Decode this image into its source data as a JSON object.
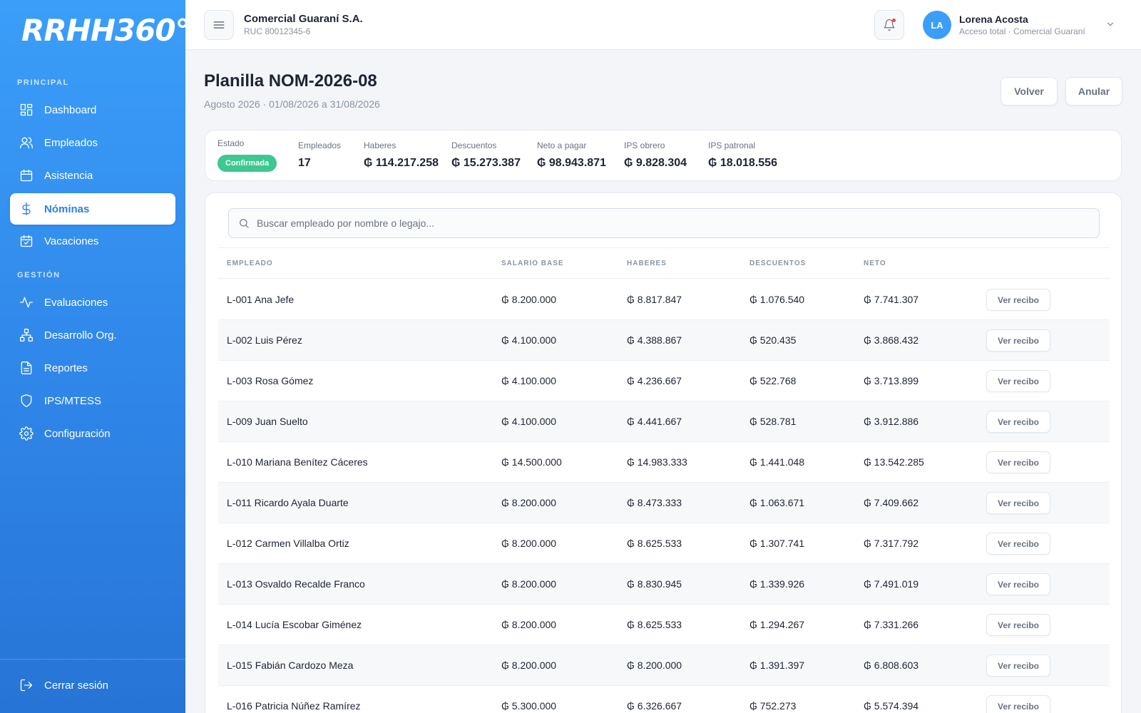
{
  "brand": {
    "logo": "RRHH360°"
  },
  "sidebar": {
    "principal_title": "PRINCIPAL",
    "gestion_title": "GESTIÓN",
    "principal": [
      {
        "label": "Dashboard",
        "icon": "dashboard-icon"
      },
      {
        "label": "Empleados",
        "icon": "users-icon"
      },
      {
        "label": "Asistencia",
        "icon": "calendar-icon"
      },
      {
        "label": "Nóminas",
        "icon": "dollar-icon",
        "active": true
      },
      {
        "label": "Vacaciones",
        "icon": "calendar-check-icon"
      }
    ],
    "gestion": [
      {
        "label": "Evaluaciones",
        "icon": "activity-icon"
      },
      {
        "label": "Desarrollo Org.",
        "icon": "org-chart-icon"
      },
      {
        "label": "Reportes",
        "icon": "document-icon"
      },
      {
        "label": "IPS/MTESS",
        "icon": "shield-icon"
      },
      {
        "label": "Configuración",
        "icon": "gear-icon"
      }
    ],
    "logout": "Cerrar sesión"
  },
  "header": {
    "company": "Comercial Guaraní S.A.",
    "ruc": "RUC 80012345-6",
    "user_initials": "LA",
    "user_name": "Lorena Acosta",
    "user_role": "Acceso total · Comercial Guaraní"
  },
  "page": {
    "title": "Planilla NOM-2026-08",
    "subtitle": "Agosto 2026 · 01/08/2026 a 31/08/2026",
    "btn_volver": "Volver",
    "btn_anular": "Anular"
  },
  "summary": {
    "estado_label": "Estado",
    "estado_value": "Confirmada",
    "empleados_label": "Empleados",
    "empleados_value": "17",
    "haberes_label": "Haberes",
    "haberes_value": "₲ 114.217.258",
    "descuentos_label": "Descuentos",
    "descuentos_value": "₲ 15.273.387",
    "neto_label": "Neto a pagar",
    "neto_value": "₲ 98.943.871",
    "ips_obrero_label": "IPS obrero",
    "ips_obrero_value": "₲ 9.828.304",
    "ips_patronal_label": "IPS patronal",
    "ips_patronal_value": "₲ 18.018.556",
    "badge_color": "#3cc891"
  },
  "search": {
    "placeholder": "Buscar empleado por nombre o legajo..."
  },
  "table": {
    "headers": {
      "empleado": "EMPLEADO",
      "salario": "SALARIO BASE",
      "haberes": "HABERES",
      "descuentos": "DESCUENTOS",
      "neto": "NETO"
    },
    "action_label": "Ver recibo",
    "rows": [
      {
        "empleado": "L-001 Ana Jefe",
        "salario": "₲ 8.200.000",
        "haberes": "₲ 8.817.847",
        "descuentos": "₲ 1.076.540",
        "neto": "₲ 7.741.307"
      },
      {
        "empleado": "L-002 Luis Pérez",
        "salario": "₲ 4.100.000",
        "haberes": "₲ 4.388.867",
        "descuentos": "₲ 520.435",
        "neto": "₲ 3.868.432"
      },
      {
        "empleado": "L-003 Rosa Gómez",
        "salario": "₲ 4.100.000",
        "haberes": "₲ 4.236.667",
        "descuentos": "₲ 522.768",
        "neto": "₲ 3.713.899"
      },
      {
        "empleado": "L-009 Juan Suelto",
        "salario": "₲ 4.100.000",
        "haberes": "₲ 4.441.667",
        "descuentos": "₲ 528.781",
        "neto": "₲ 3.912.886"
      },
      {
        "empleado": "L-010 Mariana Benítez Cáceres",
        "salario": "₲ 14.500.000",
        "haberes": "₲ 14.983.333",
        "descuentos": "₲ 1.441.048",
        "neto": "₲ 13.542.285"
      },
      {
        "empleado": "L-011 Ricardo Ayala Duarte",
        "salario": "₲ 8.200.000",
        "haberes": "₲ 8.473.333",
        "descuentos": "₲ 1.063.671",
        "neto": "₲ 7.409.662"
      },
      {
        "empleado": "L-012 Carmen Villalba Ortiz",
        "salario": "₲ 8.200.000",
        "haberes": "₲ 8.625.533",
        "descuentos": "₲ 1.307.741",
        "neto": "₲ 7.317.792"
      },
      {
        "empleado": "L-013 Osvaldo Recalde Franco",
        "salario": "₲ 8.200.000",
        "haberes": "₲ 8.830.945",
        "descuentos": "₲ 1.339.926",
        "neto": "₲ 7.491.019"
      },
      {
        "empleado": "L-014 Lucía Escobar Giménez",
        "salario": "₲ 8.200.000",
        "haberes": "₲ 8.625.533",
        "descuentos": "₲ 1.294.267",
        "neto": "₲ 7.331.266"
      },
      {
        "empleado": "L-015 Fabián Cardozo Meza",
        "salario": "₲ 8.200.000",
        "haberes": "₲ 8.200.000",
        "descuentos": "₲ 1.391.397",
        "neto": "₲ 6.808.603"
      },
      {
        "empleado": "L-016 Patricia Núñez Ramírez",
        "salario": "₲ 5.300.000",
        "haberes": "₲ 6.326.667",
        "descuentos": "₲ 752.273",
        "neto": "₲ 5.574.394"
      }
    ]
  }
}
